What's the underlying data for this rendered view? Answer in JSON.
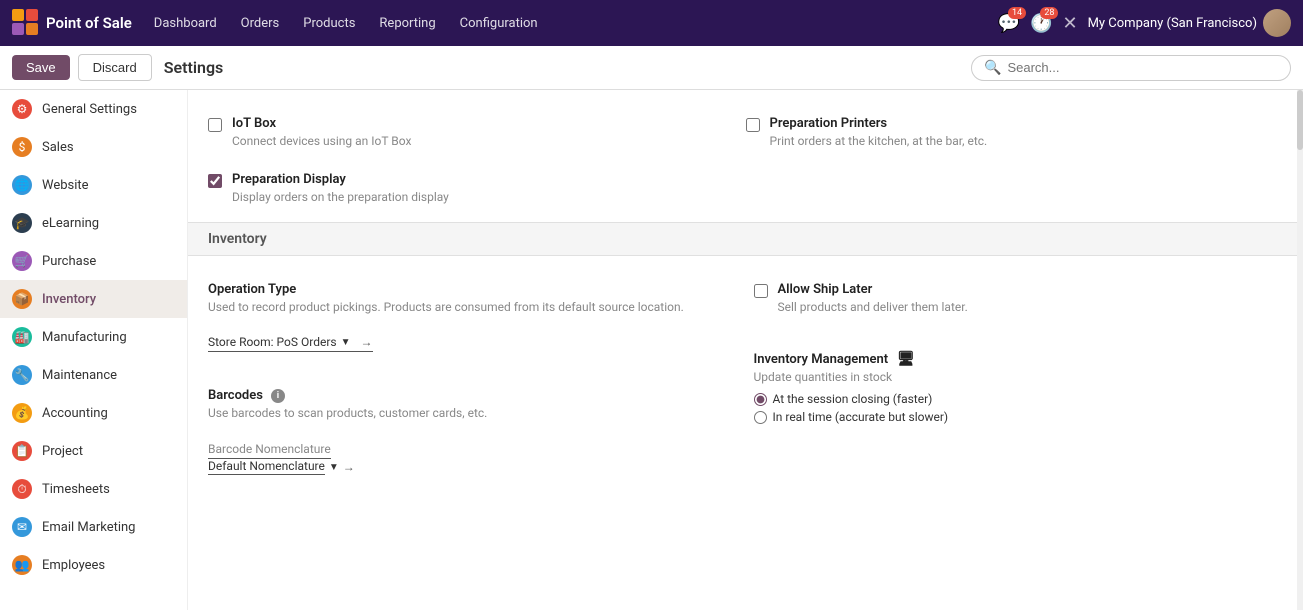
{
  "navbar": {
    "brand": "Point of Sale",
    "nav_items": [
      "Dashboard",
      "Orders",
      "Products",
      "Reporting",
      "Configuration"
    ],
    "badge_chat": "14",
    "badge_activity": "28",
    "company": "My Company (San Francisco)"
  },
  "toolbar": {
    "save_label": "Save",
    "discard_label": "Discard",
    "title": "Settings",
    "search_placeholder": "Search..."
  },
  "sidebar": {
    "items": [
      {
        "id": "general-settings",
        "label": "General Settings",
        "icon_color": "icon-general"
      },
      {
        "id": "sales",
        "label": "Sales",
        "icon_color": "icon-sales"
      },
      {
        "id": "website",
        "label": "Website",
        "icon_color": "icon-website"
      },
      {
        "id": "elearning",
        "label": "eLearning",
        "icon_color": "icon-elearning"
      },
      {
        "id": "purchase",
        "label": "Purchase",
        "icon_color": "icon-purchase"
      },
      {
        "id": "inventory",
        "label": "Inventory",
        "icon_color": "icon-inventory"
      },
      {
        "id": "manufacturing",
        "label": "Manufacturing",
        "icon_color": "icon-manufacturing"
      },
      {
        "id": "maintenance",
        "label": "Maintenance",
        "icon_color": "icon-maintenance"
      },
      {
        "id": "accounting",
        "label": "Accounting",
        "icon_color": "icon-accounting"
      },
      {
        "id": "project",
        "label": "Project",
        "icon_color": "icon-project"
      },
      {
        "id": "timesheets",
        "label": "Timesheets",
        "icon_color": "icon-timesheets"
      },
      {
        "id": "email-marketing",
        "label": "Email Marketing",
        "icon_color": "icon-email"
      },
      {
        "id": "employees",
        "label": "Employees",
        "icon_color": "icon-employees"
      }
    ]
  },
  "iot_section": {
    "iot_box_label": "IoT Box",
    "iot_box_desc": "Connect devices using an IoT Box",
    "iot_box_checked": false,
    "prep_printers_label": "Preparation Printers",
    "prep_printers_desc": "Print orders at the kitchen, at the bar, etc.",
    "prep_printers_checked": false,
    "prep_display_label": "Preparation Display",
    "prep_display_desc": "Display orders on the preparation display",
    "prep_display_checked": true
  },
  "inventory_section": {
    "header": "Inventory",
    "operation_type_label": "Operation Type",
    "operation_type_desc": "Used to record product pickings. Products are consumed from its default source location.",
    "operation_type_dropdown": "Store Room: PoS Orders",
    "allow_ship_later_label": "Allow Ship Later",
    "allow_ship_later_desc": "Sell products and deliver them later.",
    "allow_ship_later_checked": false,
    "barcodes_label": "Barcodes",
    "barcodes_desc": "Use barcodes to scan products, customer cards, etc.",
    "barcode_nomenclature_label": "Barcode Nomenclature",
    "barcode_nomenclature_value": "Default Nomenclature",
    "inventory_management_label": "Inventory Management",
    "inventory_management_icon": "🖥",
    "inventory_management_desc": "Update quantities in stock",
    "radio_session_closing": "At the session closing (faster)",
    "radio_real_time": "In real time (accurate but slower)",
    "radio_selected": "session_closing"
  }
}
